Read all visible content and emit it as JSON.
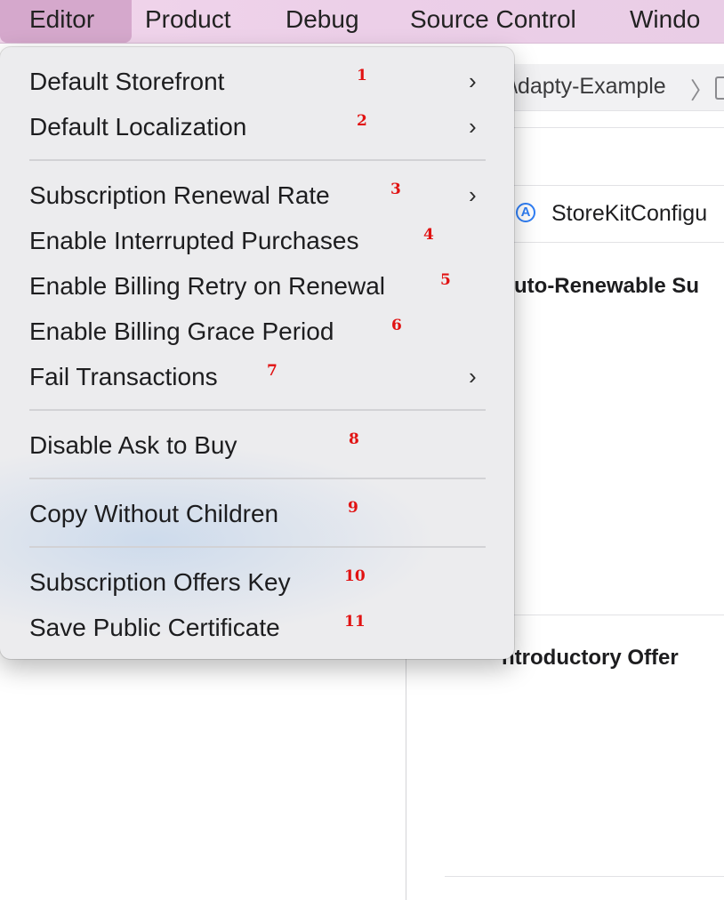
{
  "menubar": {
    "items": [
      "Editor",
      "Product",
      "Debug",
      "Source Control",
      "Windo"
    ]
  },
  "background": {
    "path_label": "\\dapty-Example",
    "path_chevron": "〉",
    "storekit_label": "StoreKitConfigu",
    "storekit_icon": "app-store-icon",
    "section_auto_renewable": "uto-Renewable Su",
    "section_introductory": "ntroductory Offer"
  },
  "menu": {
    "items": [
      {
        "label": "Default Storefront",
        "number": "1",
        "submenu": true
      },
      {
        "label": "Default Localization",
        "number": "2",
        "submenu": true
      },
      {
        "label": "Subscription Renewal Rate",
        "number": "3",
        "submenu": true
      },
      {
        "label": "Enable Interrupted Purchases",
        "number": "4",
        "submenu": false
      },
      {
        "label": "Enable Billing Retry on Renewal",
        "number": "5",
        "submenu": false
      },
      {
        "label": "Enable Billing Grace Period",
        "number": "6",
        "submenu": false
      },
      {
        "label": "Fail Transactions",
        "number": "7",
        "submenu": true
      },
      {
        "label": "Disable Ask to Buy",
        "number": "8",
        "submenu": false
      },
      {
        "label": "Copy Without Children",
        "number": "9",
        "submenu": false
      },
      {
        "label": "Subscription Offers Key",
        "number": "10",
        "submenu": false
      },
      {
        "label": "Save Public Certificate",
        "number": "11",
        "submenu": false
      }
    ],
    "chevron": "›"
  },
  "colors": {
    "menubar": "#eccfe8",
    "menubar_active": "#d5a8cc",
    "annotation_number": "#e11212",
    "storekit_icon": "#2f7ef5"
  }
}
